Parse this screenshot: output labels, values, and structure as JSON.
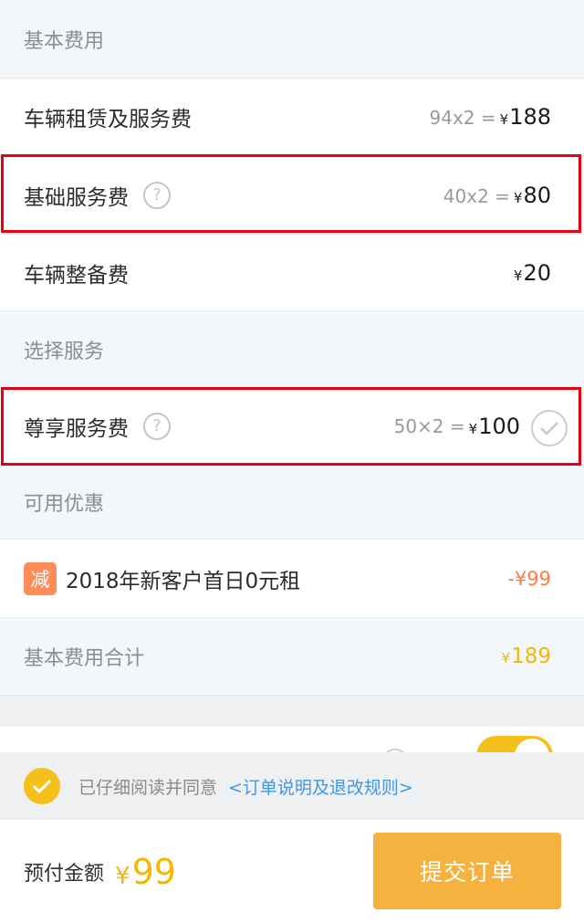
{
  "sections": {
    "basic": "基本费用",
    "select": "选择服务",
    "coupon": "可用优惠"
  },
  "basic_items": [
    {
      "label": "车辆租赁及服务费",
      "formula": "94x2 =",
      "currency": "¥",
      "amount": "188"
    },
    {
      "label": "基础服务费",
      "formula": "40x2 =",
      "currency": "¥",
      "amount": "80",
      "help_icon": "?"
    },
    {
      "label": "车辆整备费",
      "currency": "¥",
      "amount": "20"
    }
  ],
  "service_item": {
    "label": "尊享服务费",
    "formula": "50×2 =",
    "currency": "¥",
    "amount": "100",
    "help_icon": "?"
  },
  "coupon_item": {
    "badge": "减",
    "label": "2018年新客户首日0元租",
    "discount": "-¥99"
  },
  "total": {
    "label": "基本费用合计",
    "currency": "¥",
    "amount": "189"
  },
  "agreement": {
    "text": "已仔细阅读并同意",
    "link": "<订单说明及退改规则>",
    "checked": true
  },
  "footer": {
    "pay_label": "预付金额",
    "currency": "¥",
    "pay_amount": "99",
    "submit_label": "提交订单"
  },
  "colors": {
    "accent": "#f5b700",
    "button": "#f5b23e",
    "link": "#3d98e8",
    "highlight_box": "#e60012",
    "discount": "#ff7a45"
  },
  "icons": {
    "help": "question-circle-icon",
    "check": "check-circle-icon",
    "badge": "discount-badge-icon"
  }
}
